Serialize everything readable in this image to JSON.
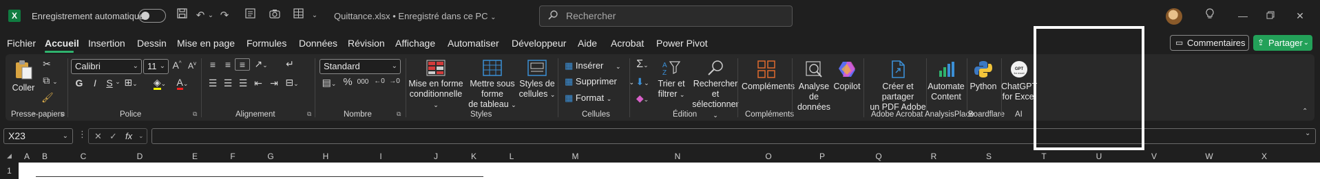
{
  "titlebar": {
    "autosave_label": "Enregistrement automatique",
    "file_title": "Quittance.xlsx • Enregistré dans ce PC",
    "file_title_chevron": "⌄",
    "search_placeholder": "Rechercher"
  },
  "menu": {
    "tabs": [
      "Fichier",
      "Accueil",
      "Insertion",
      "Dessin",
      "Mise en page",
      "Formules",
      "Données",
      "Révision",
      "Affichage",
      "Automatiser",
      "Développeur",
      "Aide",
      "Acrobat",
      "Power Pivot"
    ],
    "active_tab": "Accueil",
    "comments_label": "Commentaires",
    "share_label": "Partager"
  },
  "ribbon": {
    "groups": {
      "clipboard": "Presse-papiers",
      "font": "Police",
      "alignment": "Alignement",
      "number": "Nombre",
      "styles": "Styles",
      "cells": "Cellules",
      "editing": "Édition",
      "addins": "Compléments",
      "adobe": "Adobe Acrobat",
      "analysisplace": "AnalysisPlace",
      "boardflare": "Boardflare",
      "ai": "AI"
    },
    "paste": "Coller",
    "font_name": "Calibri",
    "font_size": "11",
    "number_format": "Standard",
    "bold": "G",
    "italic": "I",
    "underline": "S",
    "percent": "%",
    "thousands": "000",
    "conditional_l1": "Mise en forme",
    "conditional_l2": "conditionnelle",
    "table_l1": "Mettre sous forme",
    "table_l2": "de tableau",
    "cellstyles_l1": "Styles de",
    "cellstyles_l2": "cellules",
    "insert": "Insérer",
    "delete": "Supprimer",
    "format": "Format",
    "sort_l1": "Trier et",
    "sort_l2": "filtrer",
    "find_l1": "Rechercher et",
    "find_l2": "sélectionner",
    "addins": "Compléments",
    "analyze_l1": "Analyse de",
    "analyze_l2": "données",
    "copilot": "Copilot",
    "create_pdf_l1": "Créer et partager",
    "create_pdf_l2": "un PDF Adobe",
    "automate_l1": "Automate",
    "automate_l2": "Content",
    "python": "Python",
    "chatgpt_l1": "ChatGPT",
    "chatgpt_l2": "for Excel"
  },
  "formula_bar": {
    "name_box": "X23",
    "formula": "",
    "fx": "fx",
    "cancel": "✕",
    "enter": "✓"
  },
  "grid": {
    "columns": [
      "A",
      "B",
      "C",
      "D",
      "E",
      "F",
      "G",
      "H",
      "I",
      "J",
      "K",
      "L",
      "M",
      "N",
      "O",
      "P",
      "Q",
      "R",
      "S",
      "T",
      "U",
      "V",
      "W",
      "X"
    ],
    "first_row": "1"
  },
  "colors": {
    "accent_green": "#2fb36e",
    "share_green": "#23a159",
    "background": "#1f1f1f",
    "ribbon": "#292929"
  }
}
